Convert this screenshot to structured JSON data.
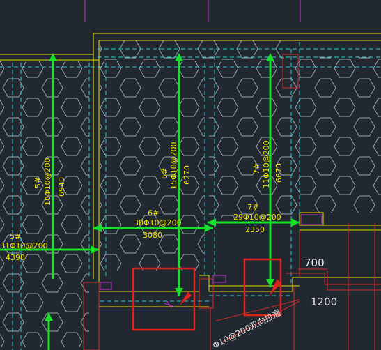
{
  "drawing": {
    "colors": {
      "background": "#212830",
      "wall_outline": "#e6e000",
      "dashed_axis": "#2ec8d8",
      "hatch": "#9aa3ac",
      "rebar": "#19e02a",
      "highlight_box": "#e0221a",
      "red_detail": "#d22a2a",
      "magenta": "#c02fc8",
      "text_yellow": "#f2e500",
      "text_white": "#e8e8e8"
    },
    "rebar_labels": {
      "r5": {
        "mark": "5#",
        "spec": "18Φ10@200",
        "length": "6940"
      },
      "r6v": {
        "mark": "6#",
        "spec": "15Φ10@200",
        "length": "6270"
      },
      "r7v": {
        "mark": "7#",
        "spec": "11Φ10@200",
        "length": "6670"
      },
      "r6h": {
        "mark": "6#",
        "spec": "30Φ10@200",
        "length": "3080"
      },
      "r7h": {
        "mark": "7#",
        "spec": "29Φ10@200",
        "length": "2350"
      },
      "r5h": {
        "mark": "5#",
        "spec": "31Φ10@200",
        "length": "4390"
      }
    },
    "dimensions": {
      "d700": "700",
      "d1200": "1200"
    },
    "diagonal_note": "Φ10@200双向拉通",
    "icons": [
      "arrow-icon",
      "arrow-icon"
    ]
  }
}
